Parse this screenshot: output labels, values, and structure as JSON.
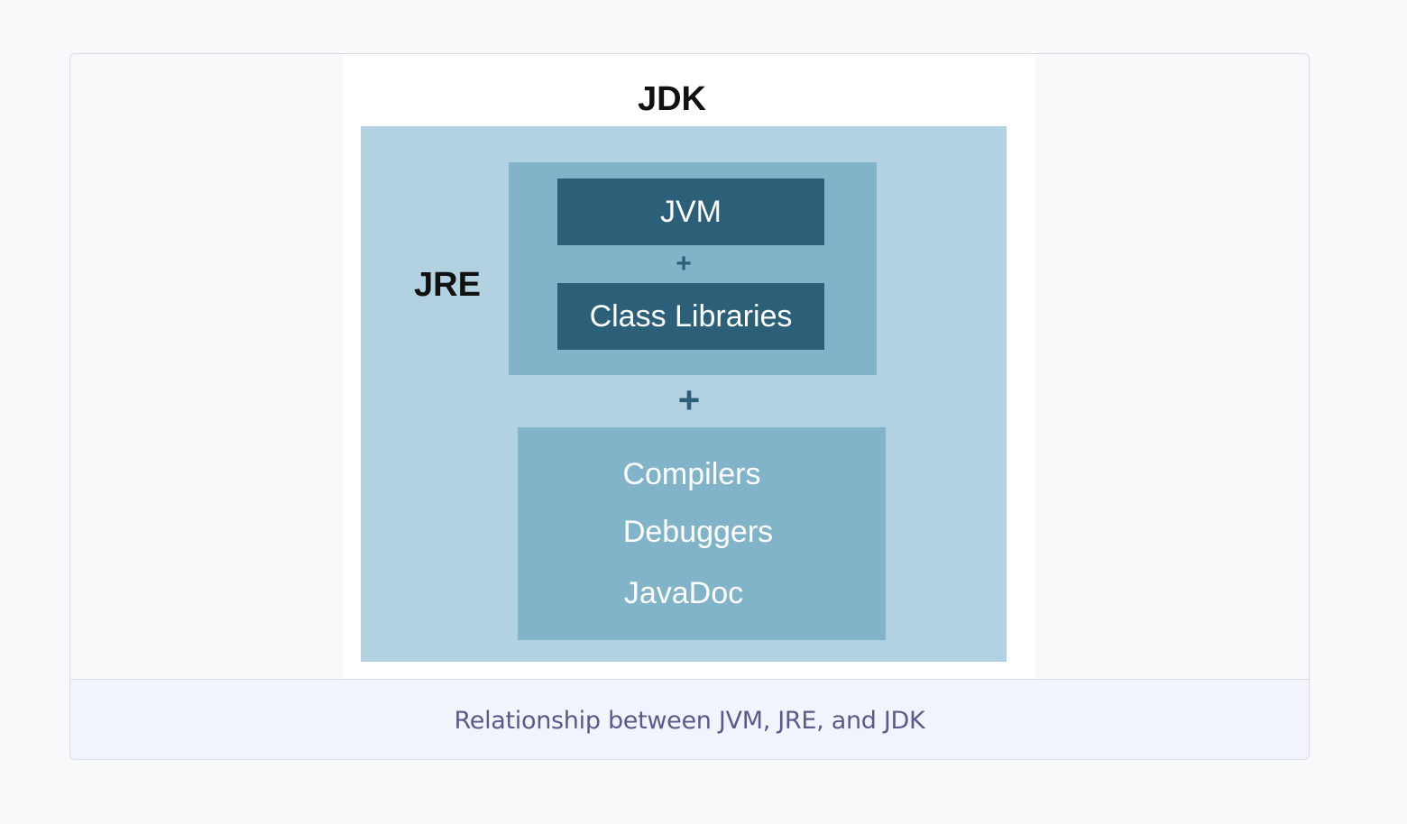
{
  "diagram": {
    "jdk_label": "JDK",
    "jre_label": "JRE",
    "jvm_label": "JVM",
    "plus_inner": "+",
    "class_libraries_label": "Class Libraries",
    "plus_outer": "+",
    "tools": [
      "Compilers",
      "Debuggers",
      "JavaDoc"
    ],
    "colors": {
      "jdk": "#b3d2e1",
      "jre": "#82b4c9",
      "jvm": "#2c6079",
      "text_dark": "#111111",
      "plus": "#2c6079"
    }
  },
  "caption": "Relationship between JVM, JRE, and JDK"
}
